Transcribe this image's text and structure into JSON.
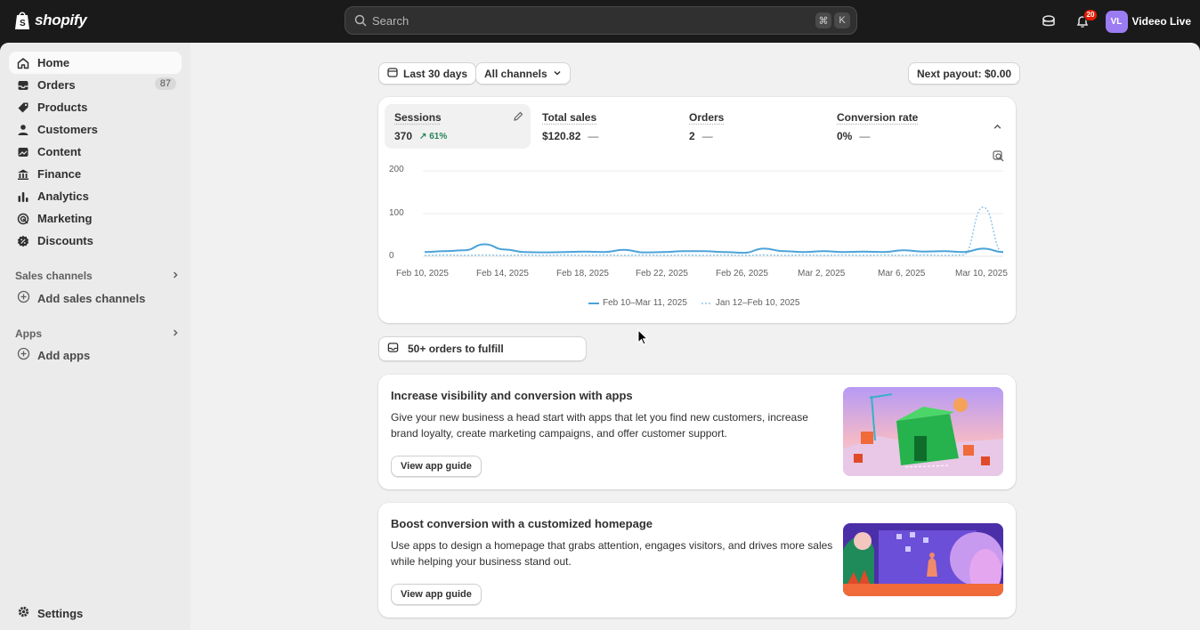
{
  "topbar": {
    "logo_text": "shopify",
    "search_placeholder": "Search",
    "shortcut_keys": [
      "⌘",
      "K"
    ],
    "notification_count": "20",
    "avatar_initials": "VL",
    "store_name": "Videeo Live",
    "icons": [
      "store-icon",
      "bell-icon"
    ]
  },
  "sidebar": {
    "items": [
      {
        "label": "Home",
        "icon": "home-icon",
        "active": true
      },
      {
        "label": "Orders",
        "icon": "inbox-icon",
        "count": "87"
      },
      {
        "label": "Products",
        "icon": "tag-icon"
      },
      {
        "label": "Customers",
        "icon": "person-icon"
      },
      {
        "label": "Content",
        "icon": "content-icon"
      },
      {
        "label": "Finance",
        "icon": "bank-icon"
      },
      {
        "label": "Analytics",
        "icon": "bar-chart-icon"
      },
      {
        "label": "Marketing",
        "icon": "target-icon"
      },
      {
        "label": "Discounts",
        "icon": "discount-icon"
      }
    ],
    "sales_channels_label": "Sales channels",
    "add_sales_channels": "Add sales channels",
    "apps_label": "Apps",
    "add_apps": "Add apps",
    "settings_label": "Settings"
  },
  "filters": {
    "date_range": "Last 30 days",
    "channels": "All channels",
    "payout": "Next payout: $0.00"
  },
  "metrics": [
    {
      "label": "Sessions",
      "value": "370",
      "delta": "61%",
      "selected": true
    },
    {
      "label": "Total sales",
      "value": "$120.82",
      "trend": "—"
    },
    {
      "label": "Orders",
      "value": "2",
      "trend": "—"
    },
    {
      "label": "Conversion rate",
      "value": "0%",
      "trend": "—"
    }
  ],
  "chart_data": {
    "type": "line",
    "yticks": [
      "200",
      "100",
      "0"
    ],
    "ylim": [
      0,
      200
    ],
    "xticks": [
      "Feb 10, 2025",
      "Feb 14, 2025",
      "Feb 18, 2025",
      "Feb 22, 2025",
      "Feb 26, 2025",
      "Mar 2, 2025",
      "Mar 6, 2025",
      "Mar 10, 2025"
    ],
    "x": [
      "Feb 10",
      "Feb 11",
      "Feb 12",
      "Feb 13",
      "Feb 14",
      "Feb 15",
      "Feb 16",
      "Feb 17",
      "Feb 18",
      "Feb 19",
      "Feb 20",
      "Feb 21",
      "Feb 22",
      "Feb 23",
      "Feb 24",
      "Feb 25",
      "Feb 26",
      "Feb 27",
      "Feb 28",
      "Mar 1",
      "Mar 2",
      "Mar 3",
      "Mar 4",
      "Mar 5",
      "Mar 6",
      "Mar 7",
      "Mar 8",
      "Mar 9",
      "Mar 10",
      "Mar 11"
    ],
    "series": [
      {
        "name": "Feb 10–Mar 11, 2025",
        "style": "solid",
        "color": "#4ba3d9",
        "values": [
          10,
          12,
          14,
          28,
          16,
          10,
          9,
          10,
          11,
          10,
          15,
          9,
          10,
          12,
          12,
          10,
          8,
          18,
          12,
          10,
          12,
          10,
          11,
          10,
          14,
          11,
          12,
          10,
          18,
          10
        ]
      },
      {
        "name": "Jan 12–Feb 10, 2025",
        "style": "dotted",
        "color": "#8fc7e8",
        "values": [
          2,
          3,
          2,
          3,
          2,
          3,
          2,
          3,
          2,
          3,
          2,
          3,
          2,
          3,
          2,
          3,
          2,
          3,
          2,
          3,
          2,
          3,
          2,
          3,
          2,
          3,
          2,
          3,
          115,
          8
        ]
      }
    ],
    "legend_position": "bottom"
  },
  "fulfill": {
    "label": "50+ orders to fulfill"
  },
  "promos": [
    {
      "title": "Increase visibility and conversion with apps",
      "body": "Give your new business a head start with apps that let you find new customers, increase brand loyalty, create marketing campaigns, and offer customer support.",
      "button": "View app guide"
    },
    {
      "title": "Boost conversion with a customized homepage",
      "body": "Use apps to design a homepage that grabs attention, engages visitors, and drives more sales while helping your business stand out.",
      "button": "View app guide"
    }
  ]
}
